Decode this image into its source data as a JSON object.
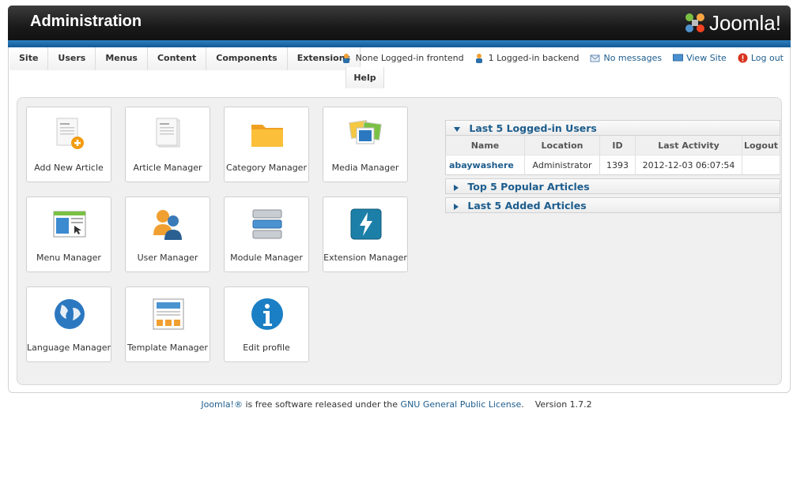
{
  "header": {
    "title": "Administration",
    "brand": "Joomla!"
  },
  "menu": {
    "items": [
      {
        "label": "Site"
      },
      {
        "label": "Users"
      },
      {
        "label": "Menus"
      },
      {
        "label": "Content"
      },
      {
        "label": "Components"
      },
      {
        "label": "Extensions"
      }
    ],
    "help": "Help"
  },
  "status": {
    "frontend": "None Logged-in frontend",
    "backend": "1 Logged-in backend",
    "messages": "No messages",
    "view_site": "View Site",
    "logout": "Log out"
  },
  "tiles": [
    {
      "label": "Add New Article",
      "icon": "add-article-icon"
    },
    {
      "label": "Article Manager",
      "icon": "article-icon"
    },
    {
      "label": "Category Manager",
      "icon": "folder-icon"
    },
    {
      "label": "Media Manager",
      "icon": "media-icon"
    },
    {
      "label": "Menu Manager",
      "icon": "menu-icon"
    },
    {
      "label": "User Manager",
      "icon": "users-icon"
    },
    {
      "label": "Module Manager",
      "icon": "module-icon"
    },
    {
      "label": "Extension Manager",
      "icon": "extension-icon"
    },
    {
      "label": "Language Manager",
      "icon": "globe-icon"
    },
    {
      "label": "Template Manager",
      "icon": "template-icon"
    },
    {
      "label": "Edit profile",
      "icon": "info-icon"
    }
  ],
  "panels": {
    "logged_in": {
      "title": "Last 5 Logged-in Users",
      "columns": [
        "Name",
        "Location",
        "ID",
        "Last Activity",
        "Logout"
      ],
      "rows": [
        {
          "name": "abaywashere",
          "location": "Administrator",
          "id": "1393",
          "last_activity": "2012-12-03 06:07:54",
          "logout": ""
        }
      ]
    },
    "popular": {
      "title": "Top 5 Popular Articles"
    },
    "added": {
      "title": "Last 5 Added Articles"
    }
  },
  "footer": {
    "brand": "Joomla!®",
    "text": " is free software released under the ",
    "license": "GNU General Public License",
    "period": ".",
    "version": "Version 1.7.2"
  },
  "colors": {
    "accent": "#1d5d8d",
    "header": "#1a1a1a",
    "bluebar": "#2d7fc0"
  }
}
